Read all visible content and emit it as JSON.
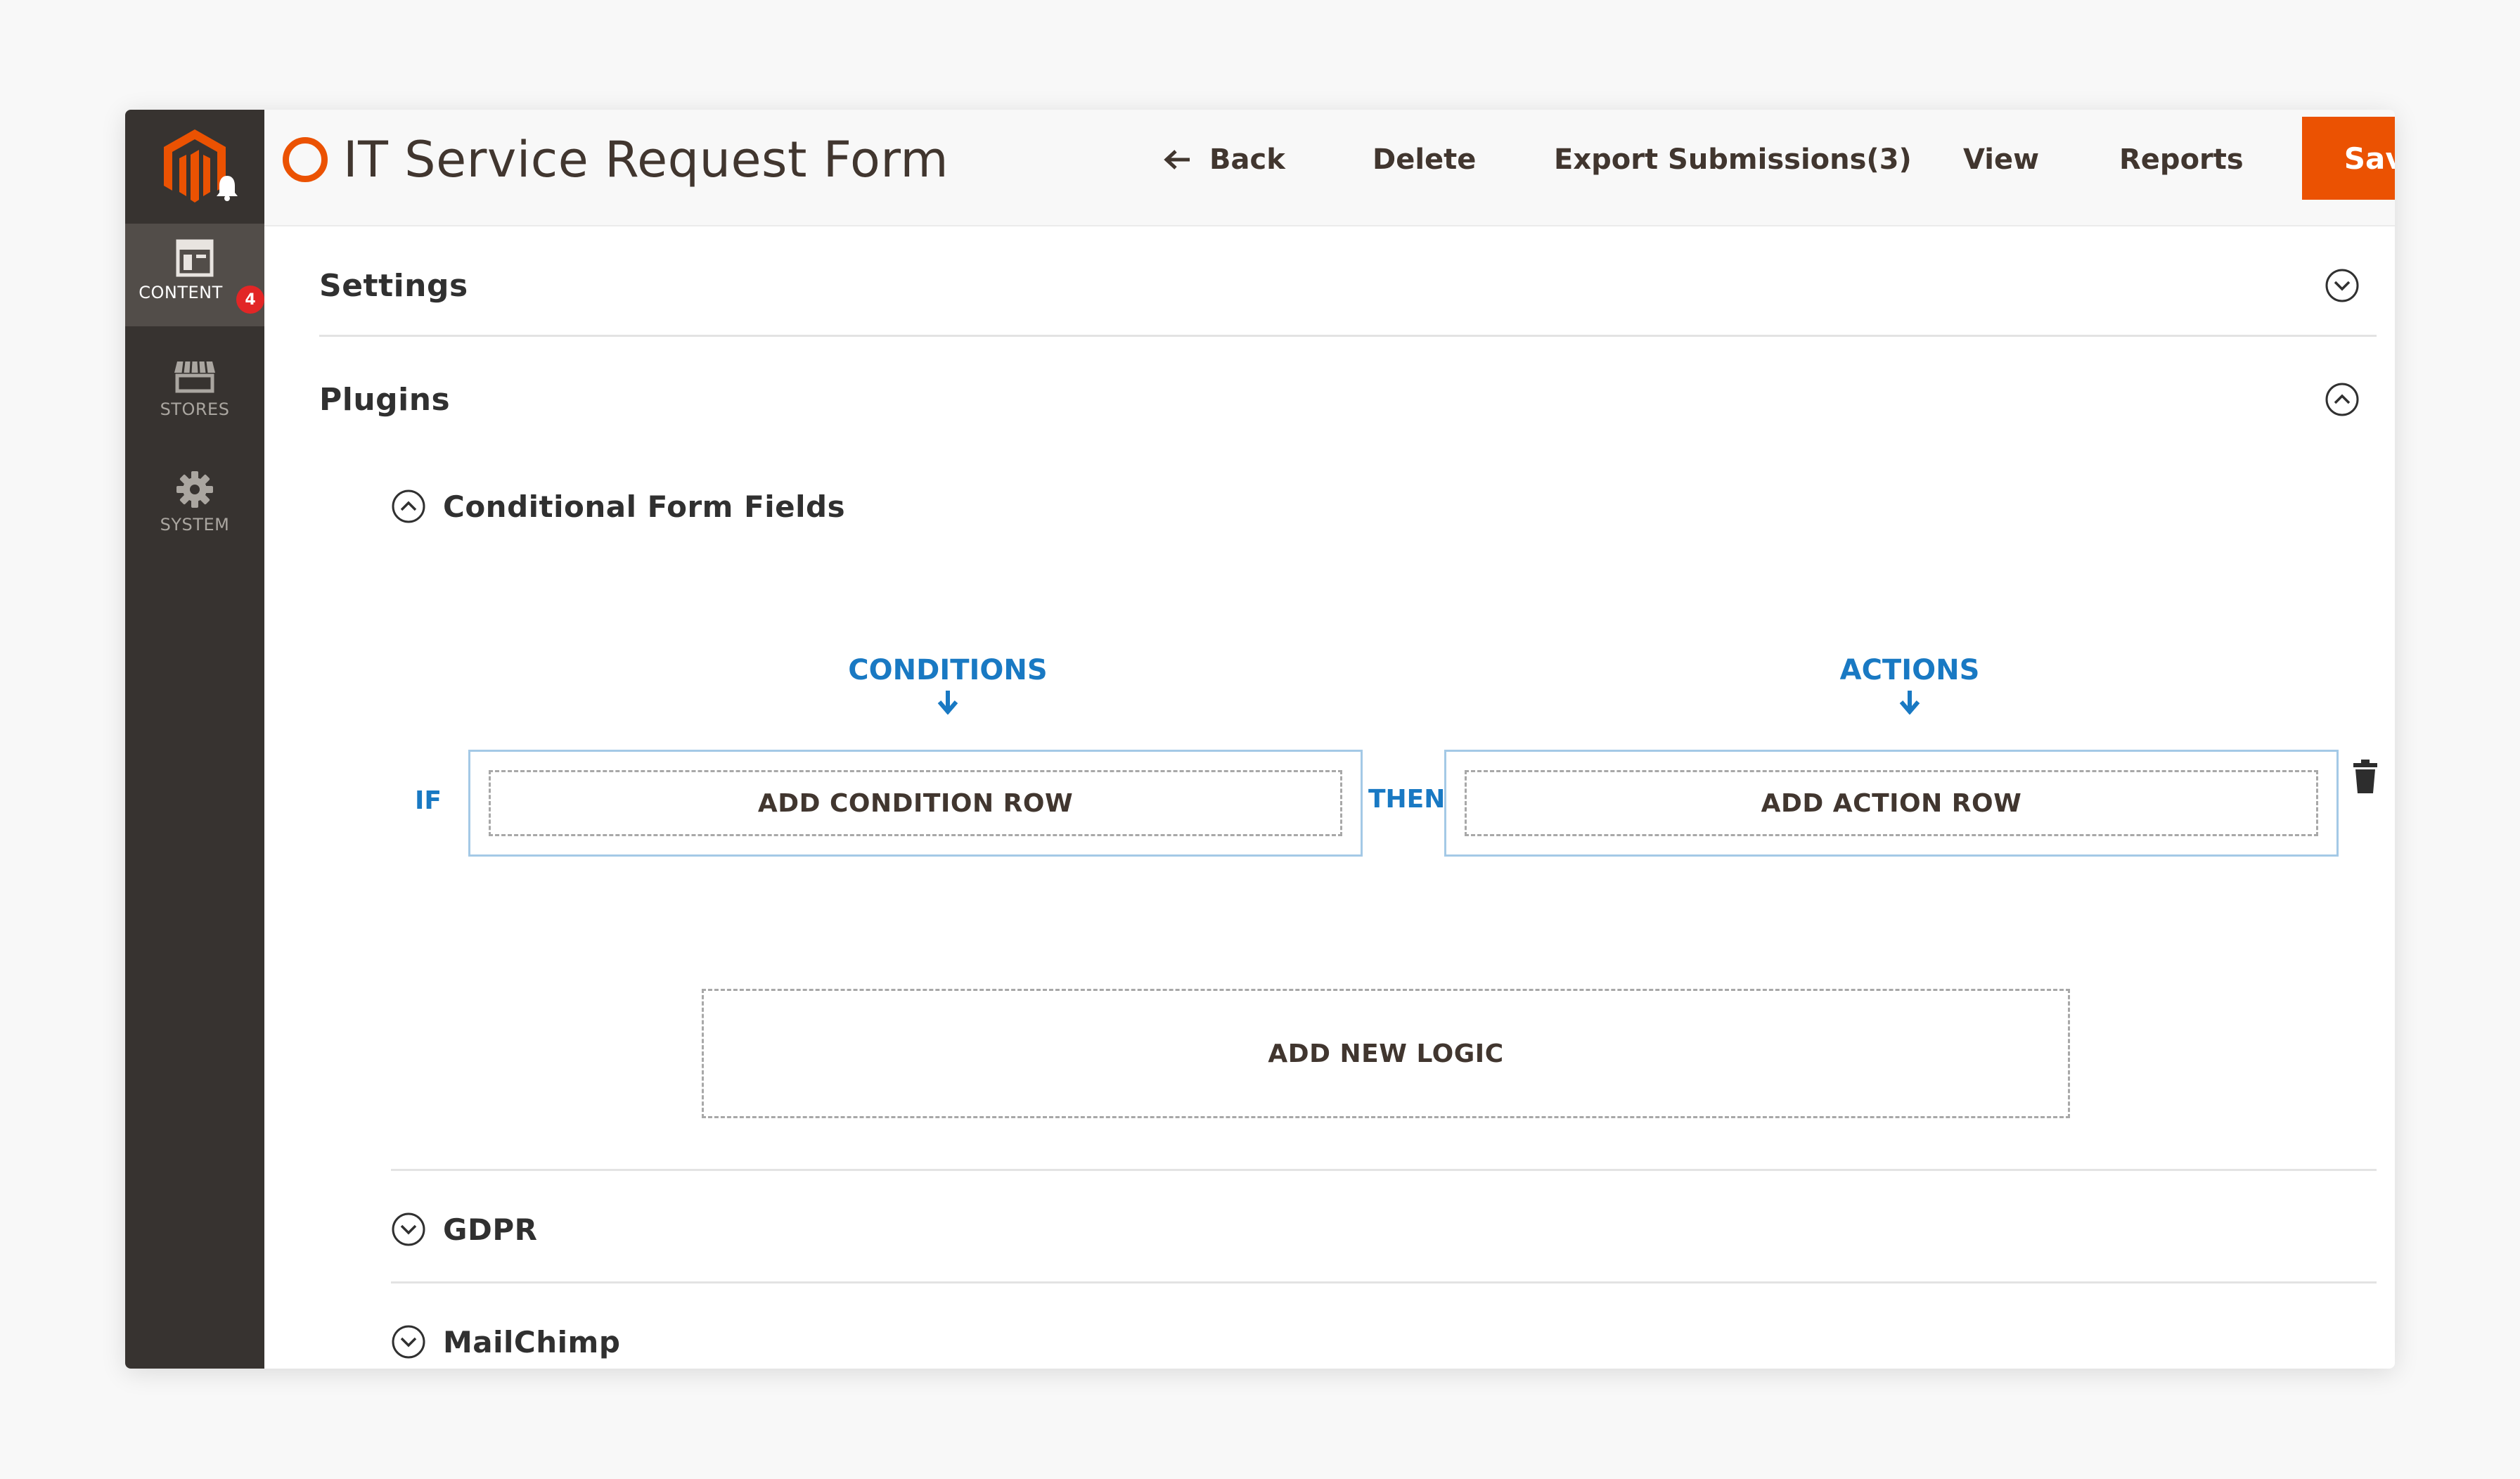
{
  "sidebar": {
    "logo_icon": "magento-logo",
    "items": [
      {
        "label": "CONTENT",
        "icon": "layout-icon",
        "active": true
      },
      {
        "label": "STORES",
        "icon": "store-icon",
        "active": false
      },
      {
        "label": "SYSTEM",
        "icon": "gear-icon",
        "active": false
      }
    ],
    "notification_count": "4"
  },
  "header": {
    "title": "IT Service Request Form",
    "back_label": "Back",
    "delete_label": "Delete",
    "export_label": "Export Submissions(3)",
    "view_label": "View",
    "reports_label": "Reports",
    "save_label": "Save"
  },
  "sections": {
    "settings": "Settings",
    "plugins": "Plugins"
  },
  "plugins": {
    "conditional": {
      "title": "Conditional Form Fields",
      "conditions_header": "CONDITIONS",
      "actions_header": "ACTIONS",
      "if_label": "IF",
      "then_label": "THEN",
      "add_condition_label": "ADD CONDITION ROW",
      "add_action_label": "ADD ACTION ROW",
      "add_new_logic_label": "ADD NEW LOGIC"
    },
    "gdpr": "GDPR",
    "mailchimp": "MailChimp"
  },
  "colors": {
    "accent": "#eb5202",
    "sidebar": "#373330",
    "link_blue": "#1979c3",
    "badge": "#e22626"
  }
}
